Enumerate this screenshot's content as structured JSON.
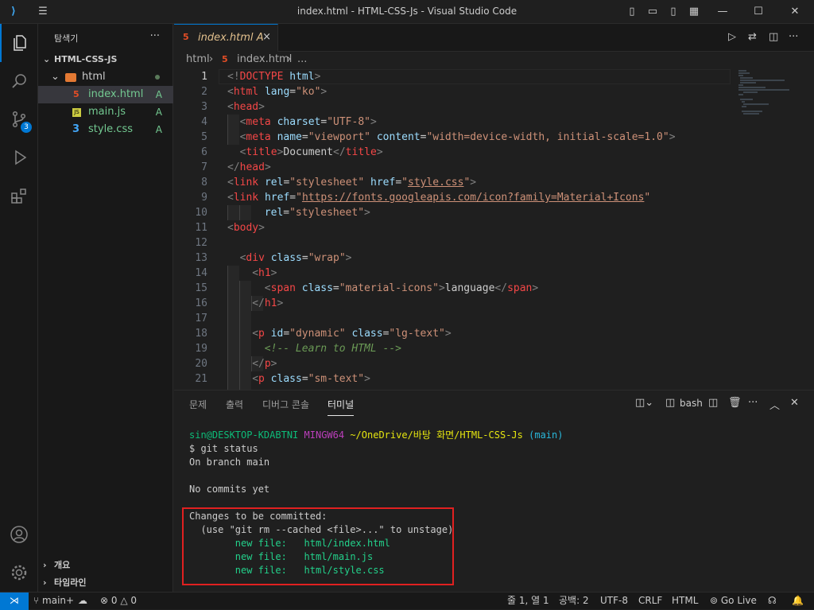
{
  "window": {
    "title": "index.html - HTML-CSS-Js - Visual Studio Code"
  },
  "activity": {
    "explorer_icon": "files-icon",
    "search_icon": "search-icon",
    "scm_icon": "source-control-icon",
    "scm_badge": "3",
    "debug_icon": "run-debug-icon",
    "extensions_icon": "extensions-icon",
    "account_icon": "account-icon",
    "settings_icon": "gear-icon"
  },
  "sidebar": {
    "title": "탐색기",
    "more": "···",
    "project": "HTML-CSS-JS",
    "folder": "html",
    "files": [
      {
        "name": "index.html",
        "status": "A"
      },
      {
        "name": "main.js",
        "status": "A"
      },
      {
        "name": "style.css",
        "status": "A"
      }
    ],
    "outline": "개요",
    "timeline": "타임라인"
  },
  "editor": {
    "tab": {
      "label": "index.html",
      "status": "A",
      "close": "×"
    },
    "breadcrumb": {
      "part1": "html",
      "part2": "index.html",
      "sep": "›",
      "rest": "..."
    },
    "line_numbers": [
      "1",
      "2",
      "3",
      "4",
      "5",
      "6",
      "7",
      "8",
      "9",
      "10",
      "11",
      "12",
      "13",
      "14",
      "15",
      "16",
      "17",
      "18",
      "19",
      "20",
      "21"
    ],
    "current_line": 1
  },
  "panel": {
    "tabs": [
      "문제",
      "출력",
      "디버그 콘솔",
      "터미널"
    ],
    "active_tab": "터미널",
    "shell": "bash",
    "terminal": {
      "user": "sin@DESKTOP-KDABTNI",
      "env": "MINGW64",
      "path": "~/OneDrive/바탕 화면/HTML-CSS-Js",
      "branch_paren": "(main)",
      "cmd": "$ git status",
      "l1": "On branch main",
      "l2": "No commits yet",
      "l3": "Changes to be committed:",
      "l4": "  (use \"git rm --cached <file>...\" to unstage)",
      "files": [
        {
          "label": "new file:",
          "path": "html/index.html"
        },
        {
          "label": "new file:",
          "path": "html/main.js"
        },
        {
          "label": "new file:",
          "path": "html/style.css"
        }
      ]
    }
  },
  "status": {
    "branch": "main+",
    "errors": "0",
    "warnings": "0",
    "position": "줄 1, 열 1",
    "spaces": "공백: 2",
    "encoding": "UTF-8",
    "eol": "CRLF",
    "language": "HTML",
    "golive": "Go Live"
  },
  "colors": {
    "accent": "#0078d4",
    "highlight_box": "#e02020",
    "git_added": "#73c991"
  }
}
